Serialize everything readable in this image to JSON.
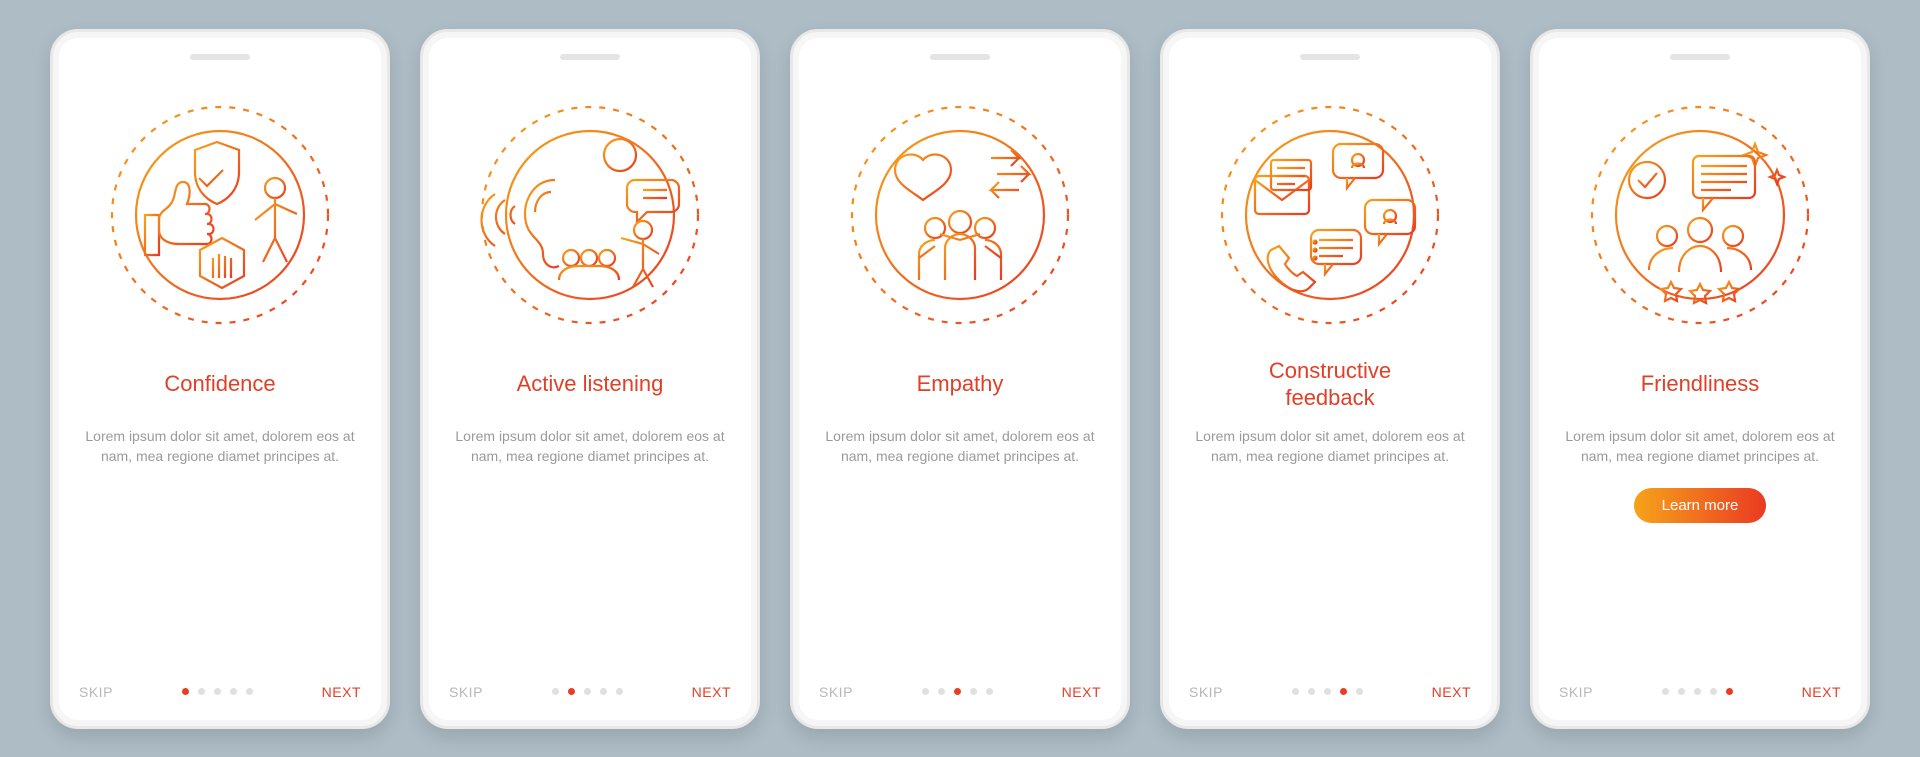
{
  "screens": [
    {
      "title": "Confidence",
      "desc": "Lorem ipsum dolor sit amet, dolorem eos at nam, mea regione diamet principes at.",
      "active_dot": 0,
      "has_cta": false,
      "icon": "confidence-icon"
    },
    {
      "title": "Active listening",
      "desc": "Lorem ipsum dolor sit amet, dolorem eos at nam, mea regione diamet principes at.",
      "active_dot": 1,
      "has_cta": false,
      "icon": "active-listening-icon"
    },
    {
      "title": "Empathy",
      "desc": "Lorem ipsum dolor sit amet, dolorem eos at nam, mea regione diamet principes at.",
      "active_dot": 2,
      "has_cta": false,
      "icon": "empathy-icon"
    },
    {
      "title": "Constructive\nfeedback",
      "desc": "Lorem ipsum dolor sit amet, dolorem eos at nam, mea regione diamet principes at.",
      "active_dot": 3,
      "has_cta": false,
      "icon": "feedback-icon"
    },
    {
      "title": "Friendliness",
      "desc": "Lorem ipsum dolor sit amet, dolorem eos at nam, mea regione diamet principes at.",
      "active_dot": 4,
      "has_cta": true,
      "icon": "friendliness-icon"
    }
  ],
  "nav": {
    "skip": "SKIP",
    "next": "NEXT",
    "dot_count": 5
  },
  "cta": {
    "label": "Learn more"
  },
  "colors": {
    "accent": "#e83d24",
    "gradient_from": "#f6a31a",
    "gradient_to": "#ea3a22"
  }
}
